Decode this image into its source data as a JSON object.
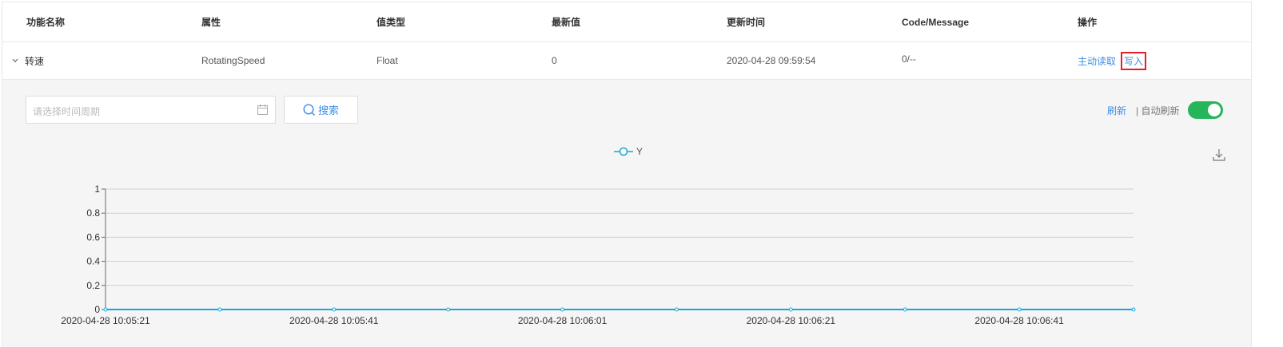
{
  "table": {
    "headers": [
      "功能名称",
      "属性",
      "值类型",
      "最新值",
      "更新时间",
      "Code/Message",
      "操作"
    ],
    "row": {
      "expand_icon": "chevron-down-icon",
      "name": "转速",
      "property": "RotatingSpeed",
      "value_type": "Float",
      "latest_value": "0",
      "update_time": "2020-04-28 09:59:54",
      "code_message": "0/--",
      "actions": {
        "read_label": "主动读取",
        "write_label": "写入"
      }
    }
  },
  "panel": {
    "date_placeholder": "请选择时间周期",
    "search_label": "搜索",
    "refresh_label": "刷新",
    "auto_refresh_label": "| 自动刷新",
    "auto_refresh_on": true,
    "accent_color": "#3d8fe6",
    "toggle_color": "#27b55a",
    "highlight_color": "#e81e25"
  },
  "chart_data": {
    "type": "line",
    "series": [
      {
        "name": "Y",
        "color": "#1ba4d9",
        "values": [
          0,
          0,
          0,
          0,
          0,
          0,
          0,
          0,
          0,
          0
        ]
      }
    ],
    "x": [
      "2020-04-28 10:05:21",
      "2020-04-28 10:05:31",
      "2020-04-28 10:05:41",
      "2020-04-28 10:05:51",
      "2020-04-28 10:06:01",
      "2020-04-28 10:06:11",
      "2020-04-28 10:06:21",
      "2020-04-28 10:06:31",
      "2020-04-28 10:06:41",
      "2020-04-28 10:06:51"
    ],
    "x_tick_labels": [
      "2020-04-28 10:05:21",
      "2020-04-28 10:05:41",
      "2020-04-28 10:06:01",
      "2020-04-28 10:06:21",
      "2020-04-28 10:06:41"
    ],
    "y_ticks": [
      0,
      0.2,
      0.4,
      0.6,
      0.8,
      1
    ],
    "y_tick_labels": [
      "0",
      "0.2",
      "0.4",
      "0.6",
      "0.8",
      "1"
    ],
    "ylim": [
      0,
      1
    ],
    "grid": true,
    "legend_position": "top-center"
  }
}
